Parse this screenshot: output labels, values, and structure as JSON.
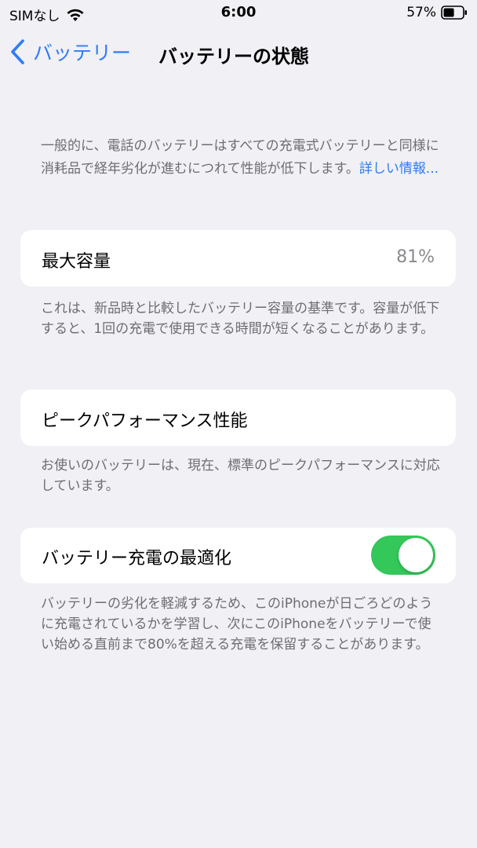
{
  "status_bar": {
    "carrier": "SIMなし",
    "time": "6:00",
    "battery_percent": "57%",
    "battery_level": 0.57
  },
  "nav": {
    "back_label": "バッテリー",
    "title": "バッテリーの状態"
  },
  "intro": {
    "text": "一般的に、電話のバッテリーはすべての充電式バッテリーと同様に消耗品で経年劣化が進むにつれて性能が低下します。",
    "link": "詳しい情報..."
  },
  "max_capacity": {
    "label": "最大容量",
    "value": "81%",
    "note": "これは、新品時と比較したバッテリー容量の基準です。容量が低下すると、1回の充電で使用できる時間が短くなることがあります。"
  },
  "peak_performance": {
    "label": "ピークパフォーマンス性能",
    "note": "お使いのバッテリーは、現在、標準のピークパフォーマンスに対応しています。"
  },
  "optimized_charging": {
    "label": "バッテリー充電の最適化",
    "enabled": true,
    "note": "バッテリーの劣化を軽減するため、このiPhoneが日ごろどのように充電されているかを学習し、次にこのiPhoneをバッテリーで使い始める直前まで80%を超える充電を保留することがあります。"
  },
  "colors": {
    "accent": "#2f7cf6",
    "toggle_on": "#34c759",
    "background": "#f0f0f5"
  }
}
